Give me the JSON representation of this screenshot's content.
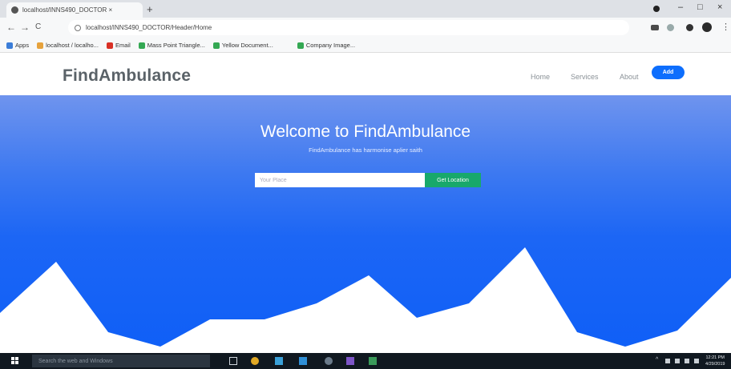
{
  "browser": {
    "tab_title": "localhost/INNS490_DOCTOR ×",
    "tab_close": "×",
    "new_tab": "+",
    "url": "localhost/INNS490_DOCTOR/Header/Home",
    "window_controls": {
      "minimize": "–",
      "maximize": "□",
      "close": "×"
    },
    "nav": {
      "back": "←",
      "forward": "→",
      "reload": "C"
    },
    "bookmarks": [
      "Apps",
      "localhost / localho...",
      "Email",
      "Mass Point Triangle...",
      "Yellow Document...",
      "Company Image..."
    ]
  },
  "site": {
    "brand": "FindAmbulance",
    "nav": {
      "home": "Home",
      "services": "Services",
      "about": "About",
      "add": "Add"
    },
    "hero": {
      "title": "Welcome to FindAmbulance",
      "subtitle": "FindAmbulance has harmonise aplier saith",
      "search_placeholder": "Your Place",
      "button": "Get Location"
    },
    "colors": {
      "accent": "#0d6efd",
      "hero": "#1c66f5",
      "location_button": "#18a86b"
    }
  },
  "taskbar": {
    "search_placeholder": "Search the web and Windows",
    "clock_time": "12:21 PM",
    "clock_date": "4/29/2019"
  }
}
